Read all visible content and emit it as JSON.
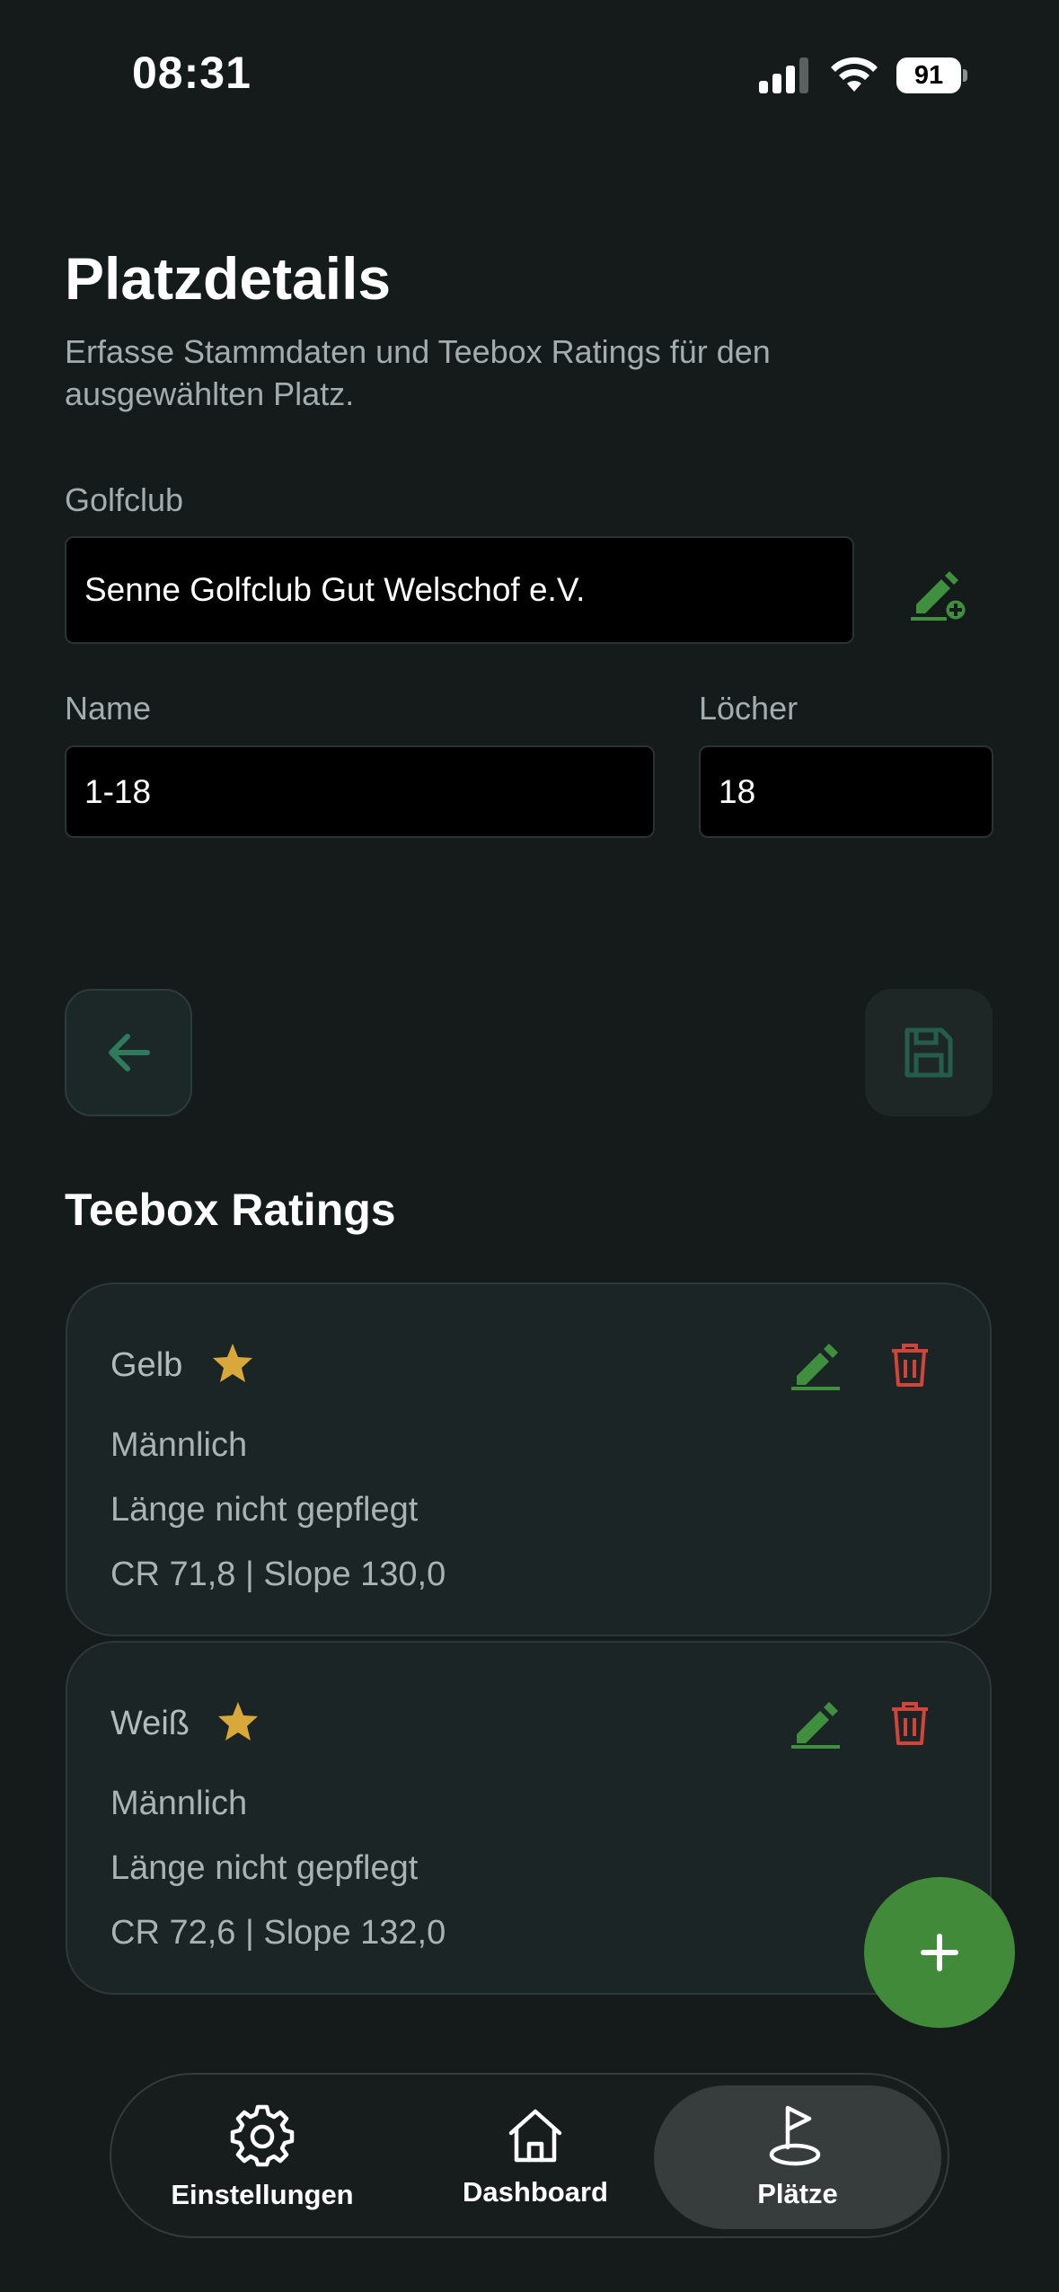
{
  "status_bar": {
    "time": "08:31",
    "battery": "91"
  },
  "header": {
    "title": "Platzdetails",
    "subtitle": "Erfasse Stammdaten und Teebox Ratings für den ausgewählten Platz."
  },
  "form": {
    "golfclub_label": "Golfclub",
    "golfclub_value": "Senne Golfclub Gut Welschof e.V.",
    "name_label": "Name",
    "name_value": "1-18",
    "holes_label": "Löcher",
    "holes_value": "18"
  },
  "teebox": {
    "section_title": "Teebox Ratings",
    "ratings": [
      {
        "name": "Gelb",
        "gender": "Männlich",
        "length": "Länge nicht gepflegt",
        "values": "CR 71,8 | Slope 130,0"
      },
      {
        "name": "Weiß",
        "gender": "Männlich",
        "length": "Länge nicht gepflegt",
        "values": "CR 72,6 | Slope 132,0"
      }
    ]
  },
  "nav": {
    "items": [
      {
        "label": "Einstellungen",
        "icon": "gear-icon"
      },
      {
        "label": "Dashboard",
        "icon": "home-icon"
      },
      {
        "label": "Plätze",
        "icon": "golf-flag-icon",
        "active": true
      }
    ]
  },
  "colors": {
    "background": "#151b1b",
    "accent_green": "#418a39",
    "icon_green": "#3f8f3f",
    "delete_red": "#d2433a",
    "star_gold": "#d8a93a"
  }
}
